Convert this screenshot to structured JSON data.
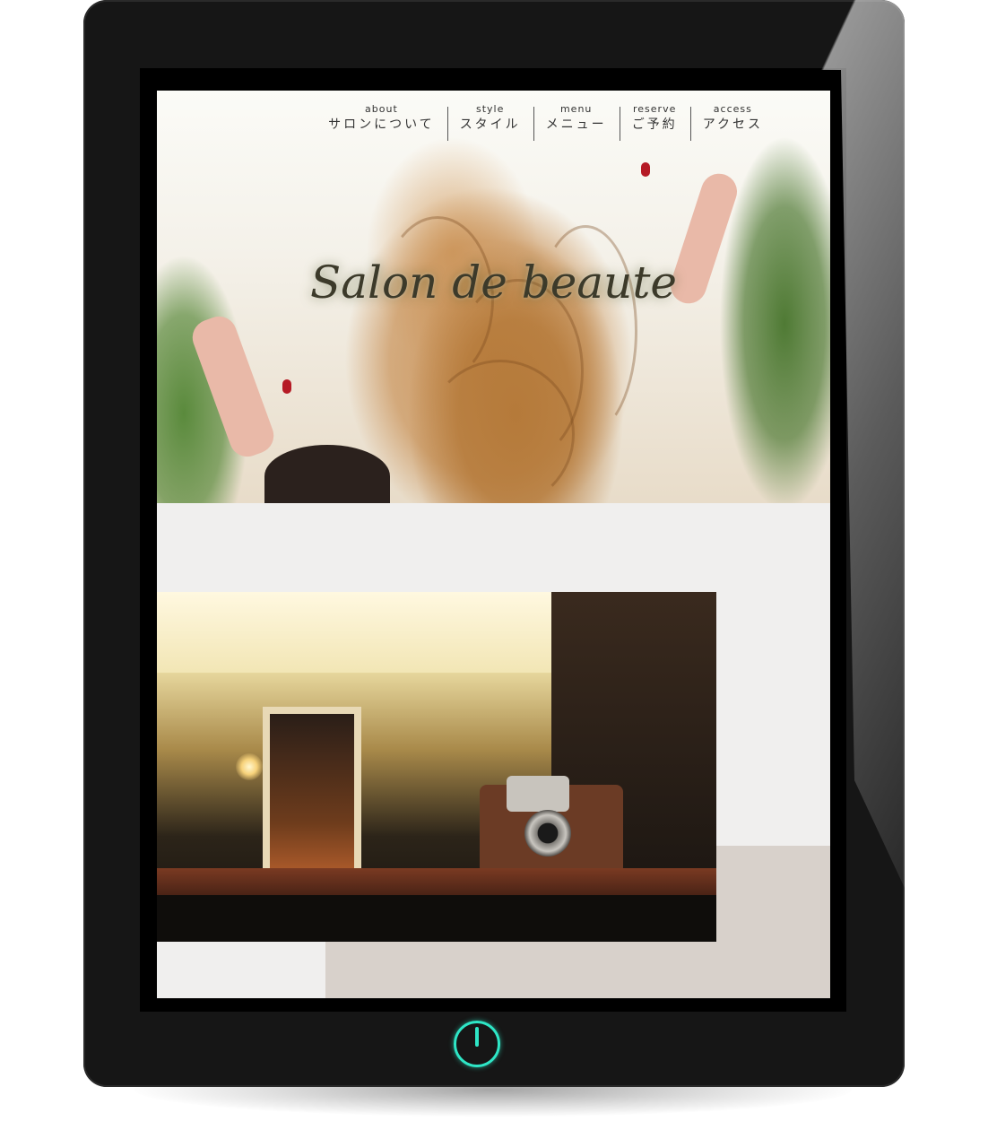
{
  "nav": {
    "items": [
      {
        "en": "about",
        "ja": "サロンについて"
      },
      {
        "en": "style",
        "ja": "スタイル"
      },
      {
        "en": "menu",
        "ja": "メニュー"
      },
      {
        "en": "reserve",
        "ja": "ご予約"
      },
      {
        "en": "access",
        "ja": "アクセス"
      }
    ]
  },
  "hero": {
    "logo_text": "Salon de beaute"
  },
  "colors": {
    "device_body": "#161616",
    "power_accent": "#2ee6c6",
    "page_background": "#f0efee",
    "accent_block": "#d8d1cb"
  },
  "icons": {
    "power": "power-icon"
  }
}
